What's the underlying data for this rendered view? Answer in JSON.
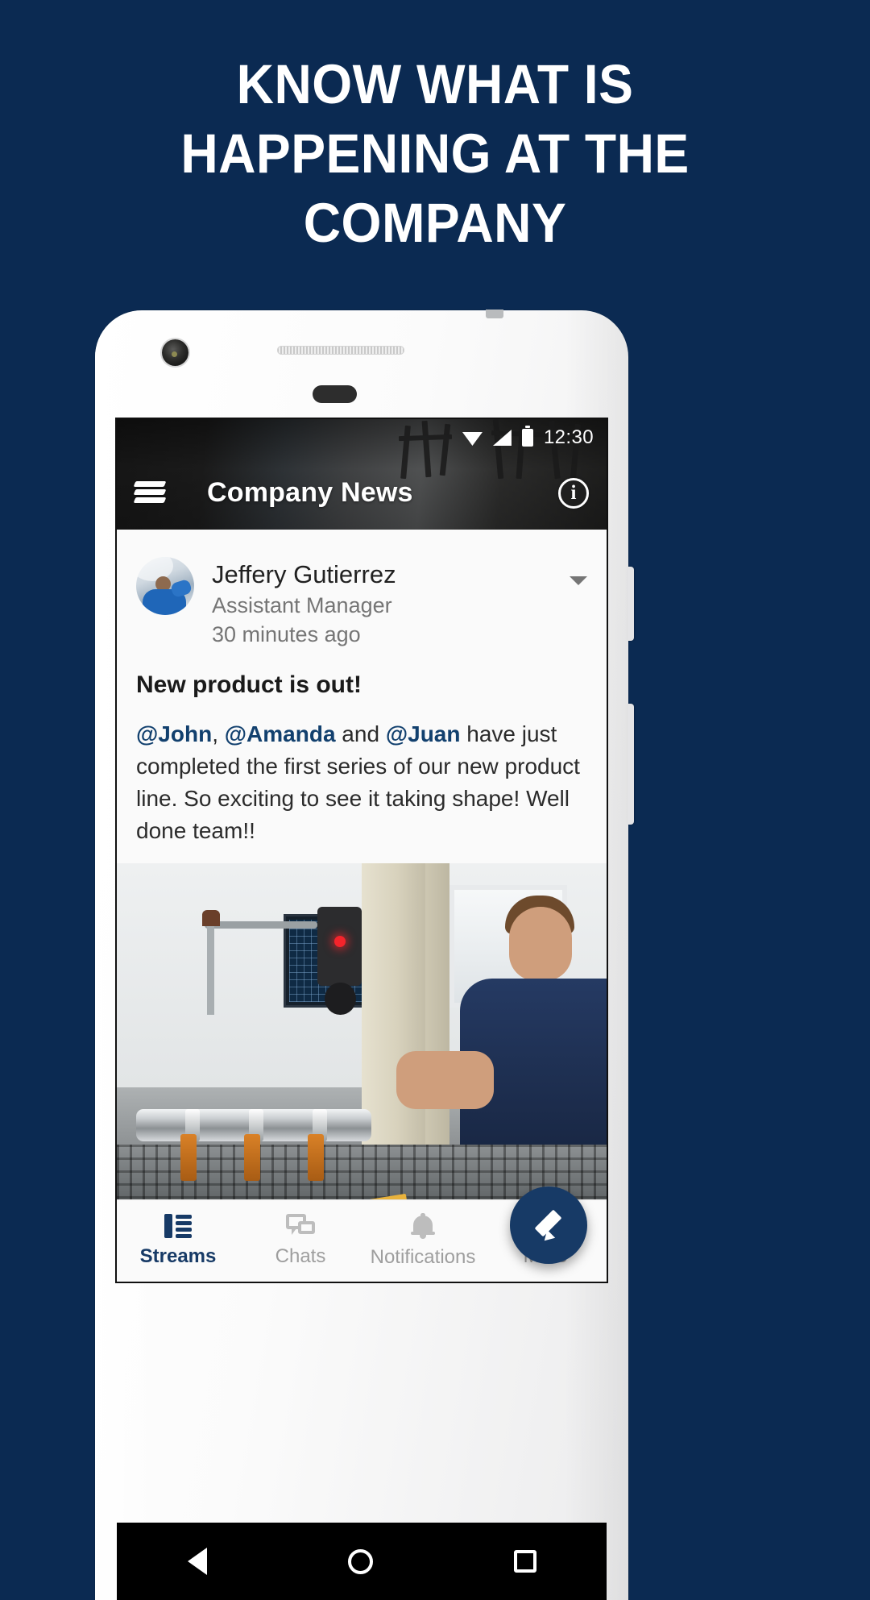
{
  "promo": {
    "headline_lines": [
      "KNOW WHAT IS",
      "HAPPENING AT THE",
      "COMPANY"
    ],
    "background_color": "#0b2a52"
  },
  "phone": {
    "statusbar": {
      "time": "12:30",
      "icons": [
        "wifi-icon",
        "signal-icon",
        "battery-icon"
      ]
    },
    "toolbar": {
      "menu_icon": "layers-stack-icon",
      "title": "Company News",
      "action_icon": "info-icon"
    },
    "post": {
      "author_name": "Jeffery Gutierrez",
      "author_role": "Assistant Manager",
      "timestamp": "30 minutes ago",
      "overflow_icon": "chevron-down-icon",
      "title": "New product is out!",
      "body_parts": [
        {
          "type": "mention",
          "text": "@John"
        },
        {
          "type": "text",
          "text": ", "
        },
        {
          "type": "mention",
          "text": "@Amanda"
        },
        {
          "type": "text",
          "text": " and "
        },
        {
          "type": "mention",
          "text": "@Juan"
        },
        {
          "type": "text",
          "text": " have just completed the first series of our new product line. So exciting to see it taking shape! Well done team!!"
        }
      ],
      "mention_color": "#12406e",
      "image_alt": "coordinate measuring machine with technician"
    },
    "fab": {
      "icon": "pencil-icon",
      "color": "#173a66"
    },
    "bottom_nav": {
      "active_index": 0,
      "active_color": "#173a66",
      "inactive_color": "#9e9e9e",
      "items": [
        {
          "label": "Streams",
          "icon": "streams-list-icon"
        },
        {
          "label": "Chats",
          "icon": "chat-bubbles-icon"
        },
        {
          "label": "Notifications",
          "icon": "bell-icon"
        },
        {
          "label": "More",
          "icon": "grid-dots-icon"
        }
      ]
    },
    "android_nav": {
      "back": "back-triangle-icon",
      "home": "home-circle-icon",
      "recents": "recents-square-icon"
    }
  }
}
